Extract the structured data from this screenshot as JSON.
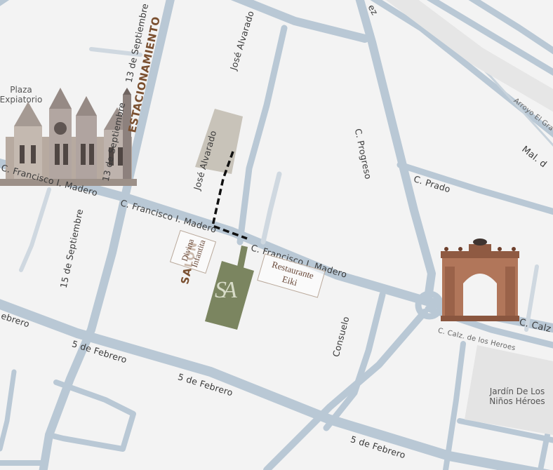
{
  "streets": {
    "madero_west": "C. Francisco I. Madero",
    "madero_mid": "C. Francisco I. Madero",
    "madero_east": "C. Francisco I. Madero",
    "septiembre_north": "13 de Septiembre",
    "septiembre_mid": "13 de Septiembre",
    "septiembre_south": "15 de Septiembre",
    "alvarado_north": "José Alvarado",
    "alvarado_south": "José Alvarado",
    "progreso": "C. Progreso",
    "prado": "C. Prado",
    "febrero_west": "ebrero",
    "febrero_1": "5 de Febrero",
    "febrero_2": "5 de Febrero",
    "febrero_3": "5 de Febrero",
    "consuelo": "Consuelo",
    "calz_heroes": "C. Calz. de los Heroes",
    "calz_east": "C. Calz",
    "arroyo": "Arroyo El Gra",
    "mal": "Mal. d",
    "top_fragment": "ez"
  },
  "places": {
    "plaza": "Plaza Expiatorio",
    "jardin": "Jardín De Los Niños Héroes"
  },
  "venues": {
    "parking": "ESTACIONAMIENTO",
    "salon": "SALÓN",
    "salon_monogram": "SA",
    "divina": "Divina Infantita",
    "restaurante": "Restaurante Eiki"
  },
  "colors": {
    "road": "#b8c7d4",
    "salon": "#7b8560",
    "parking": "#c8c2b8",
    "label_brown": "#7a4f2f"
  },
  "icons": {
    "cathedral": "cathedral-icon",
    "arch": "arch-icon"
  }
}
